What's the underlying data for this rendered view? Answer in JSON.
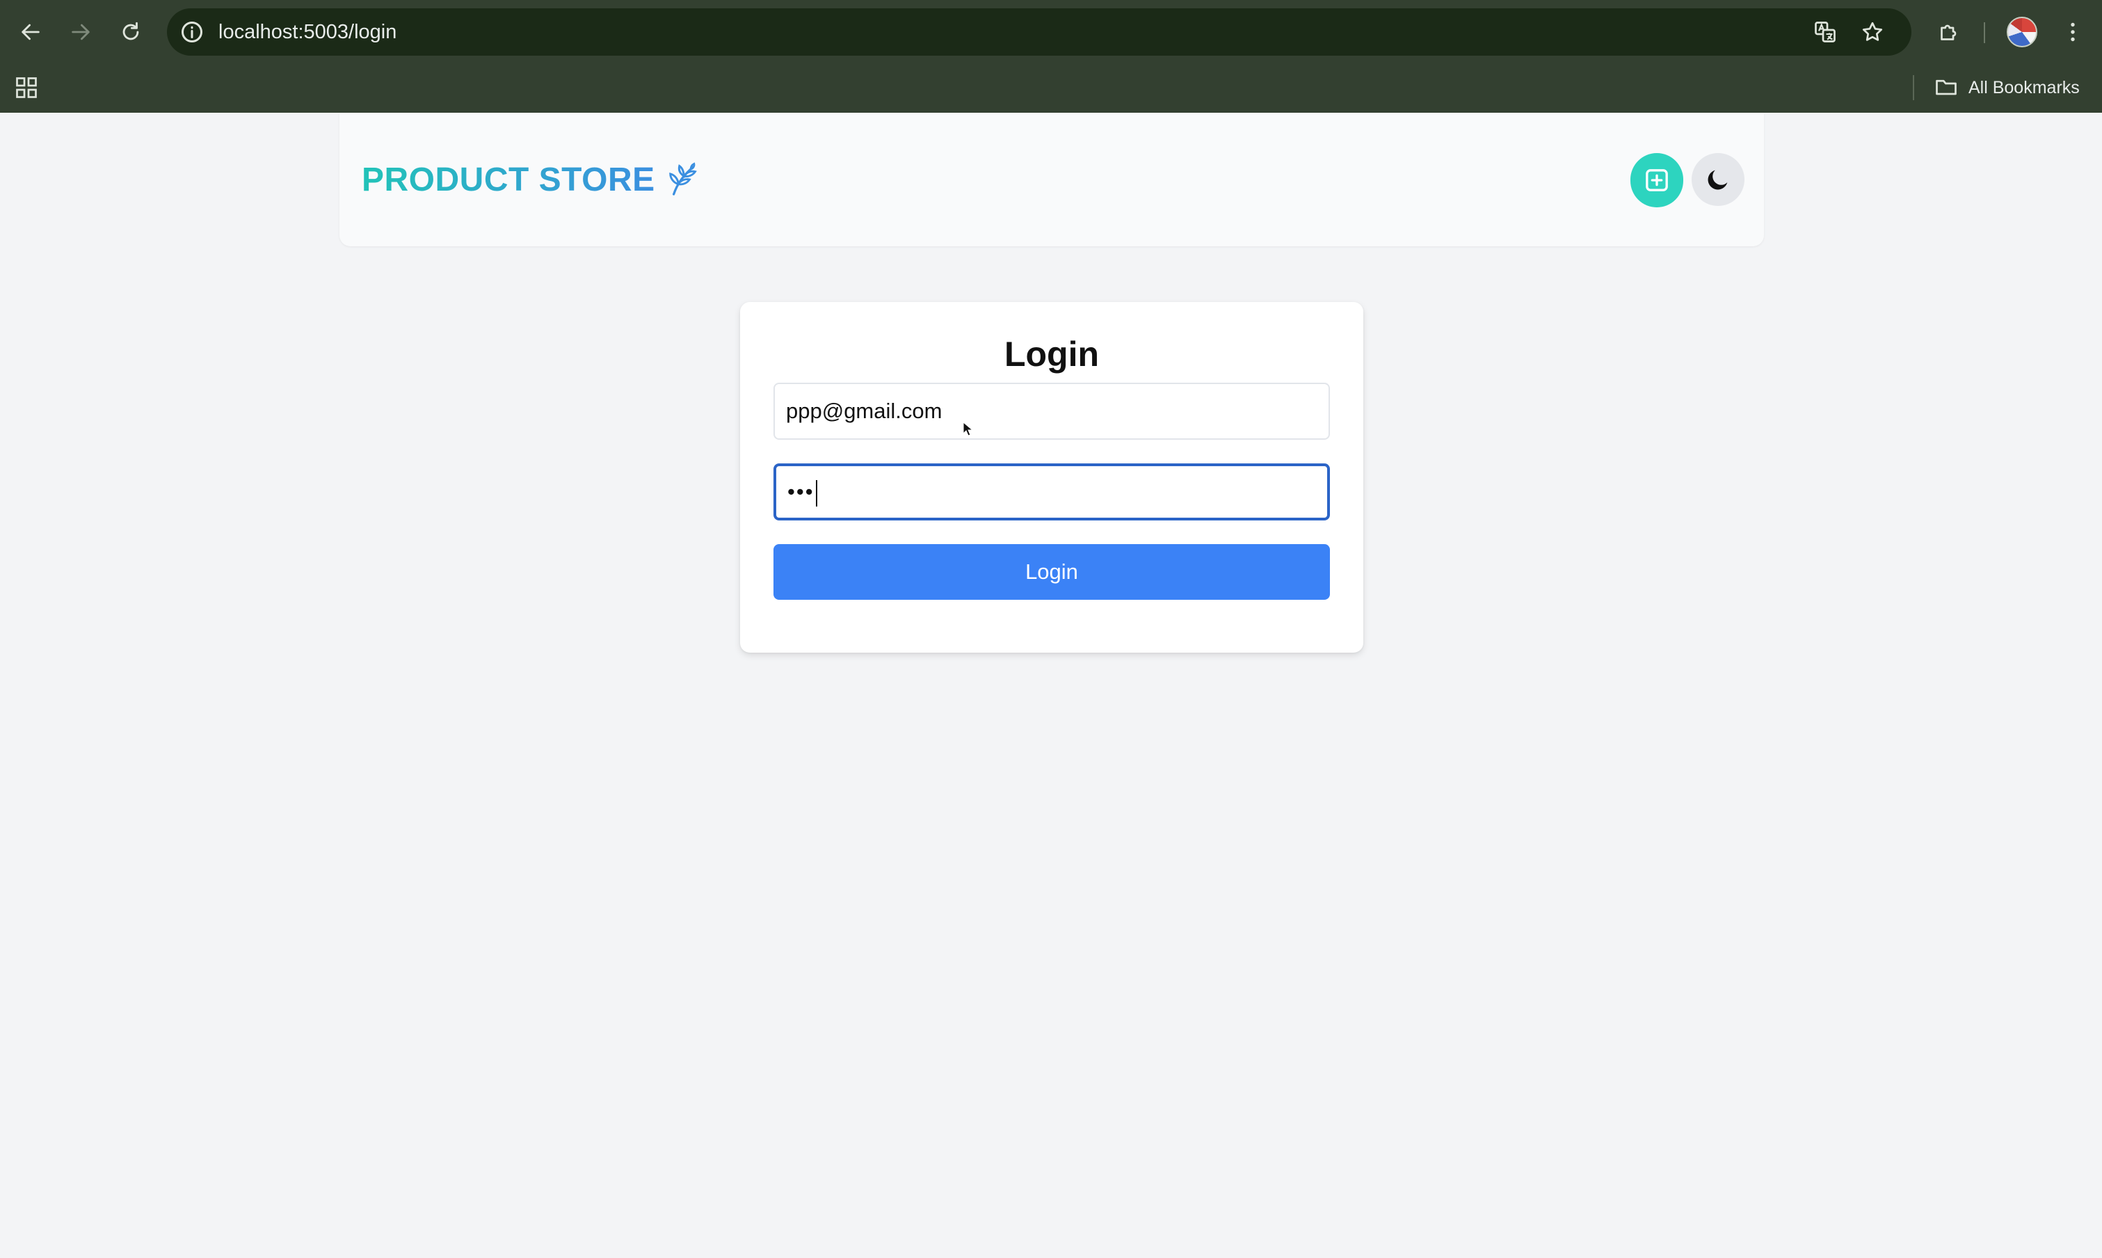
{
  "browser": {
    "url": "localhost:5003/login",
    "bookmarks_label": "All Bookmarks",
    "icons": [
      "back-arrow-icon",
      "forward-arrow-icon",
      "reload-icon",
      "site-info-icon",
      "translate-icon",
      "star-icon",
      "extensions-icon",
      "profile-avatar",
      "kebab-menu-icon",
      "apps-grid-icon",
      "folder-icon"
    ]
  },
  "navbar": {
    "brand": "PRODUCT STORE",
    "brand_icon": "wheat-leaf-icon",
    "create_icon": "plus-square-icon",
    "theme_icon": "moon-icon",
    "brand_gradient": [
      "#22c3b8",
      "#3b8fe0"
    ]
  },
  "login": {
    "title": "Login",
    "email_value": "ppp@gmail.com",
    "password_mask": "•••",
    "submit_label": "Login"
  },
  "colors": {
    "chrome_bg": "#334030",
    "omnibox_bg": "#1b2a17",
    "page_bg": "#f3f4f6",
    "create_button": "#2dd4bf",
    "primary_button": "#3b82f6",
    "focus_ring": "#2b64c7"
  }
}
